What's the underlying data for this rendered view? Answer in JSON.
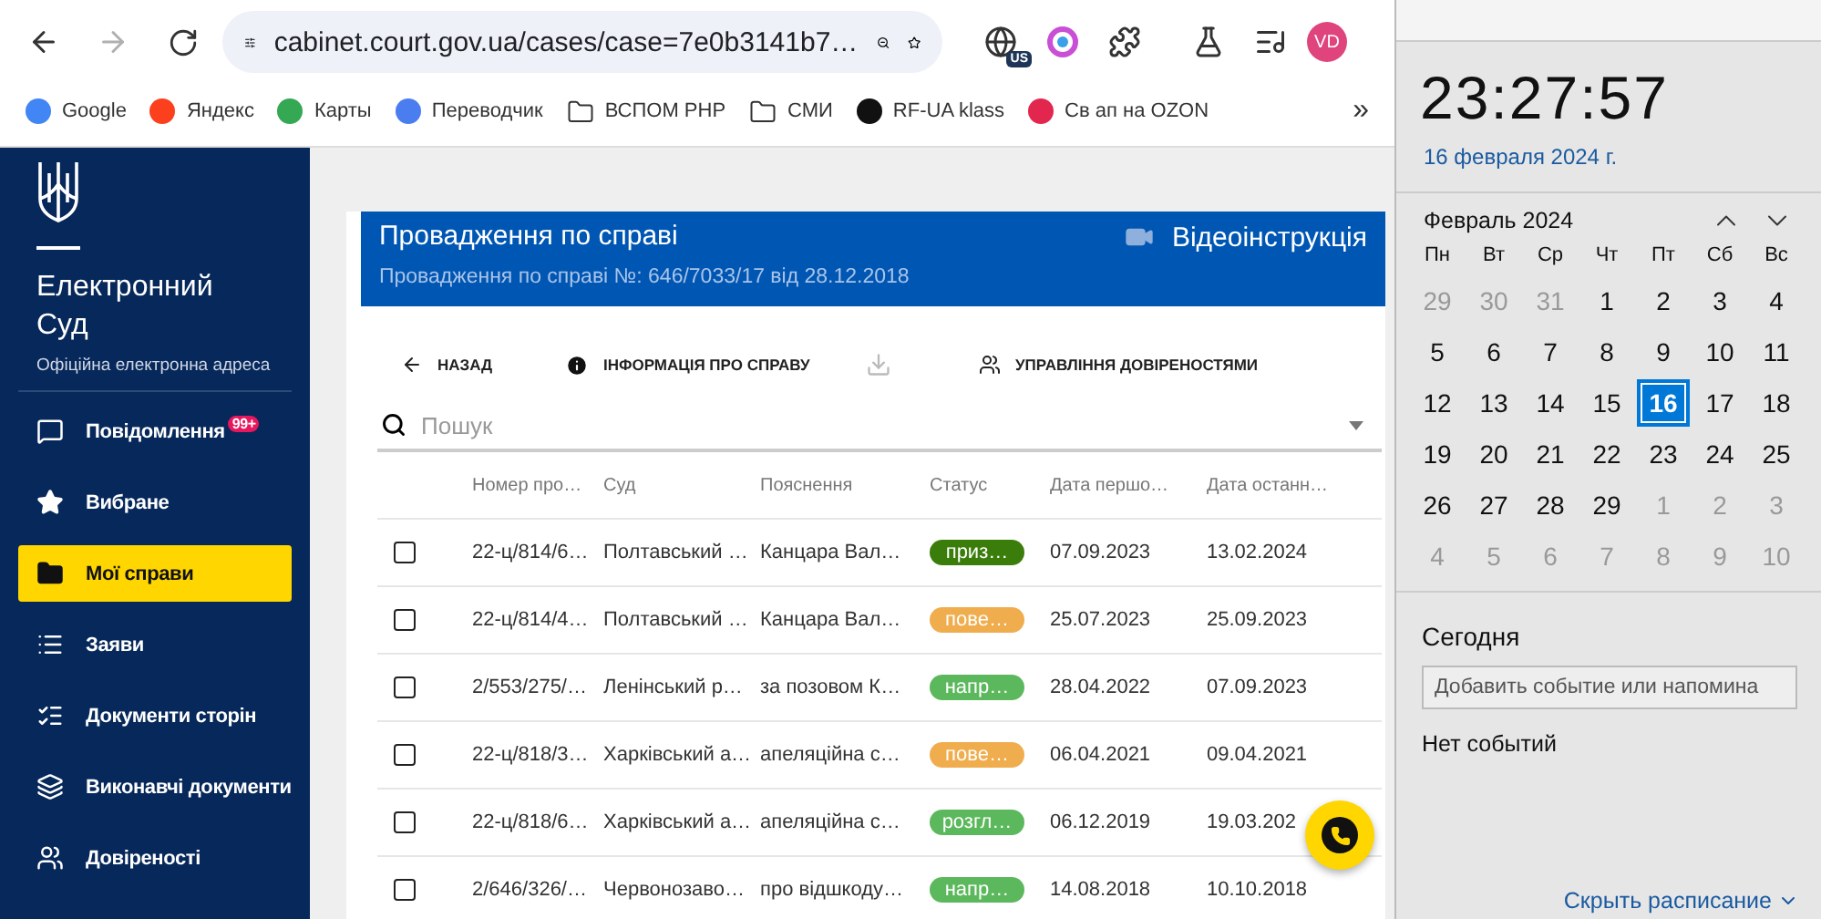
{
  "browser": {
    "back": {
      "disabled": false
    },
    "forward": {
      "disabled": true
    },
    "url": "cabinet.court.gov.ua/cases/case=7e0b3141b7…",
    "region_badge": "US",
    "avatar": "VD",
    "bookmarks": [
      {
        "kind": "google",
        "label": "Google"
      },
      {
        "kind": "yandex",
        "label": "Яндекс"
      },
      {
        "kind": "maps",
        "label": "Карты"
      },
      {
        "kind": "translate",
        "label": "Переводчик"
      },
      {
        "kind": "folder",
        "label": "ВСПОМ РНР"
      },
      {
        "kind": "folder",
        "label": "СМИ"
      },
      {
        "kind": "dark",
        "label": "RF-UA klass"
      },
      {
        "kind": "ozon",
        "label": "Св ап на OZON"
      }
    ],
    "bookmarks_overflow": "»"
  },
  "sidebar": {
    "title": "Електронний Суд",
    "subtitle": "Офіційна електронна адреса",
    "items": [
      {
        "kind": "message",
        "label": "Повідомлення",
        "badge": "99+",
        "selected": false
      },
      {
        "kind": "star",
        "label": "Вибране",
        "selected": false
      },
      {
        "kind": "folder",
        "label": "Мої справи",
        "selected": true
      },
      {
        "kind": "list",
        "label": "Заяви",
        "selected": false
      },
      {
        "kind": "checklist",
        "label": "Документи сторін",
        "selected": false
      },
      {
        "kind": "layers",
        "label": "Виконавчі документи",
        "selected": false
      },
      {
        "kind": "people",
        "label": "Довіреності",
        "selected": false
      }
    ]
  },
  "header": {
    "title": "Провадження по справі",
    "subtitle": "Провадження по справі №: 646/7033/17 від 28.12.2018",
    "video_link": "Відеоінструкція"
  },
  "actions": [
    {
      "kind": "back",
      "label": "НАЗАД"
    },
    {
      "kind": "info",
      "label": "ІНФОРМАЦІЯ ПРО СПРАВУ"
    },
    {
      "kind": "download"
    },
    {
      "kind": "people",
      "label": "УПРАВЛІННЯ ДОВІРЕНОСТЯМИ"
    }
  ],
  "search": {
    "placeholder": "Пошук"
  },
  "table": {
    "columns": [
      "Номер про…",
      "Суд",
      "Пояснення",
      "Статус",
      "Дата першо…",
      "Дата останн…"
    ],
    "rows": [
      {
        "checked": false,
        "number": "22-ц/814/6…",
        "court": "Полтавський …",
        "note": "Канцара Вал…",
        "status": {
          "text": "приз…",
          "color": "#3a7d0a"
        },
        "first": "07.09.2023",
        "last": "13.02.2024"
      },
      {
        "checked": false,
        "number": "22-ц/814/4…",
        "court": "Полтавський …",
        "note": "Канцара Вал…",
        "status": {
          "text": "пове…",
          "color": "#f0ad4e"
        },
        "first": "25.07.2023",
        "last": "25.09.2023"
      },
      {
        "checked": false,
        "number": "2/553/275/…",
        "court": "Ленінський р…",
        "note": "за позовом К…",
        "status": {
          "text": "напр…",
          "color": "#5cb85c"
        },
        "first": "28.04.2022",
        "last": "07.09.2023"
      },
      {
        "checked": false,
        "number": "22-ц/818/3…",
        "court": "Харківський а…",
        "note": "апеляційна с…",
        "status": {
          "text": "пове…",
          "color": "#f0ad4e"
        },
        "first": "06.04.2021",
        "last": "09.04.2021"
      },
      {
        "checked": false,
        "number": "22-ц/818/6…",
        "court": "Харківський а…",
        "note": "апеляційна с…",
        "status": {
          "text": "розгл…",
          "color": "#5cb85c"
        },
        "first": "06.12.2019",
        "last": "19.03.202"
      },
      {
        "checked": false,
        "number": "2/646/326/…",
        "court": "Червонозаво…",
        "note": "про відшкоду…",
        "status": {
          "text": "напр…",
          "color": "#5cb85c"
        },
        "first": "14.08.2018",
        "last": "10.10.2018"
      }
    ]
  },
  "calendar": {
    "time": "23:27:57",
    "date": "16 февраля 2024 г.",
    "month": "Февраль 2024",
    "weekdays": [
      "Пн",
      "Вт",
      "Ср",
      "Чт",
      "Пт",
      "Сб",
      "Вс"
    ],
    "days": [
      {
        "day": "29",
        "muted": true,
        "selected": false
      },
      {
        "day": "30",
        "muted": true,
        "selected": false
      },
      {
        "day": "31",
        "muted": true,
        "selected": false
      },
      {
        "day": "1",
        "muted": false,
        "selected": false
      },
      {
        "day": "2",
        "muted": false,
        "selected": false
      },
      {
        "day": "3",
        "muted": false,
        "selected": false
      },
      {
        "day": "4",
        "muted": false,
        "selected": false
      },
      {
        "day": "5",
        "muted": false,
        "selected": false
      },
      {
        "day": "6",
        "muted": false,
        "selected": false
      },
      {
        "day": "7",
        "muted": false,
        "selected": false
      },
      {
        "day": "8",
        "muted": false,
        "selected": false
      },
      {
        "day": "9",
        "muted": false,
        "selected": false
      },
      {
        "day": "10",
        "muted": false,
        "selected": false
      },
      {
        "day": "11",
        "muted": false,
        "selected": false
      },
      {
        "day": "12",
        "muted": false,
        "selected": false
      },
      {
        "day": "13",
        "muted": false,
        "selected": false
      },
      {
        "day": "14",
        "muted": false,
        "selected": false
      },
      {
        "day": "15",
        "muted": false,
        "selected": false
      },
      {
        "day": "16",
        "muted": false,
        "selected": true
      },
      {
        "day": "17",
        "muted": false,
        "selected": false
      },
      {
        "day": "18",
        "muted": false,
        "selected": false
      },
      {
        "day": "19",
        "muted": false,
        "selected": false
      },
      {
        "day": "20",
        "muted": false,
        "selected": false
      },
      {
        "day": "21",
        "muted": false,
        "selected": false
      },
      {
        "day": "22",
        "muted": false,
        "selected": false
      },
      {
        "day": "23",
        "muted": false,
        "selected": false
      },
      {
        "day": "24",
        "muted": false,
        "selected": false
      },
      {
        "day": "25",
        "muted": false,
        "selected": false
      },
      {
        "day": "26",
        "muted": false,
        "selected": false
      },
      {
        "day": "27",
        "muted": false,
        "selected": false
      },
      {
        "day": "28",
        "muted": false,
        "selected": false
      },
      {
        "day": "29",
        "muted": false,
        "selected": false
      },
      {
        "day": "1",
        "muted": true,
        "selected": false
      },
      {
        "day": "2",
        "muted": true,
        "selected": false
      },
      {
        "day": "3",
        "muted": true,
        "selected": false
      },
      {
        "day": "4",
        "muted": true,
        "selected": false
      },
      {
        "day": "5",
        "muted": true,
        "selected": false
      },
      {
        "day": "6",
        "muted": true,
        "selected": false
      },
      {
        "day": "7",
        "muted": true,
        "selected": false
      },
      {
        "day": "8",
        "muted": true,
        "selected": false
      },
      {
        "day": "9",
        "muted": true,
        "selected": false
      },
      {
        "day": "10",
        "muted": true,
        "selected": false
      }
    ],
    "today_heading": "Сегодня",
    "event_placeholder": "Добавить событие или напомина",
    "no_events": "Нет событий",
    "hide_link": "Скрыть расписание"
  }
}
